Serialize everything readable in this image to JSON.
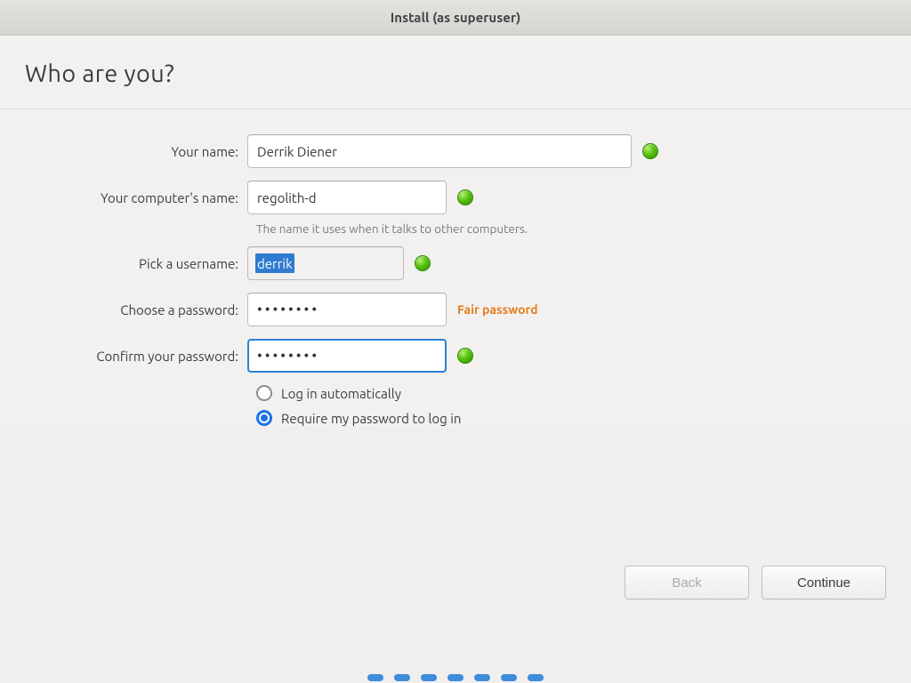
{
  "window": {
    "title": "Install (as superuser)"
  },
  "page": {
    "title": "Who are you?"
  },
  "labels": {
    "name": "Your name:",
    "computer": "Your computer's name:",
    "comp_hint": "The name it uses when it talks to other computers.",
    "username": "Pick a username:",
    "password": "Choose a password:",
    "confirm": "Confirm your password:"
  },
  "values": {
    "name": "Derrik Diener",
    "computer": "regolith-d",
    "username": "derrik",
    "password": "••••••••",
    "confirm": "••••••••",
    "strength": "Fair password"
  },
  "login_options": {
    "auto": "Log in automatically",
    "require": "Require my password to log in",
    "selected": "require"
  },
  "buttons": {
    "back": "Back",
    "continue": "Continue"
  },
  "colors": {
    "accent": "#1a73e8",
    "focus": "#2b7fd9",
    "warn": "#e77c1d",
    "ok": "#57c20a"
  },
  "progress_dots": 7
}
